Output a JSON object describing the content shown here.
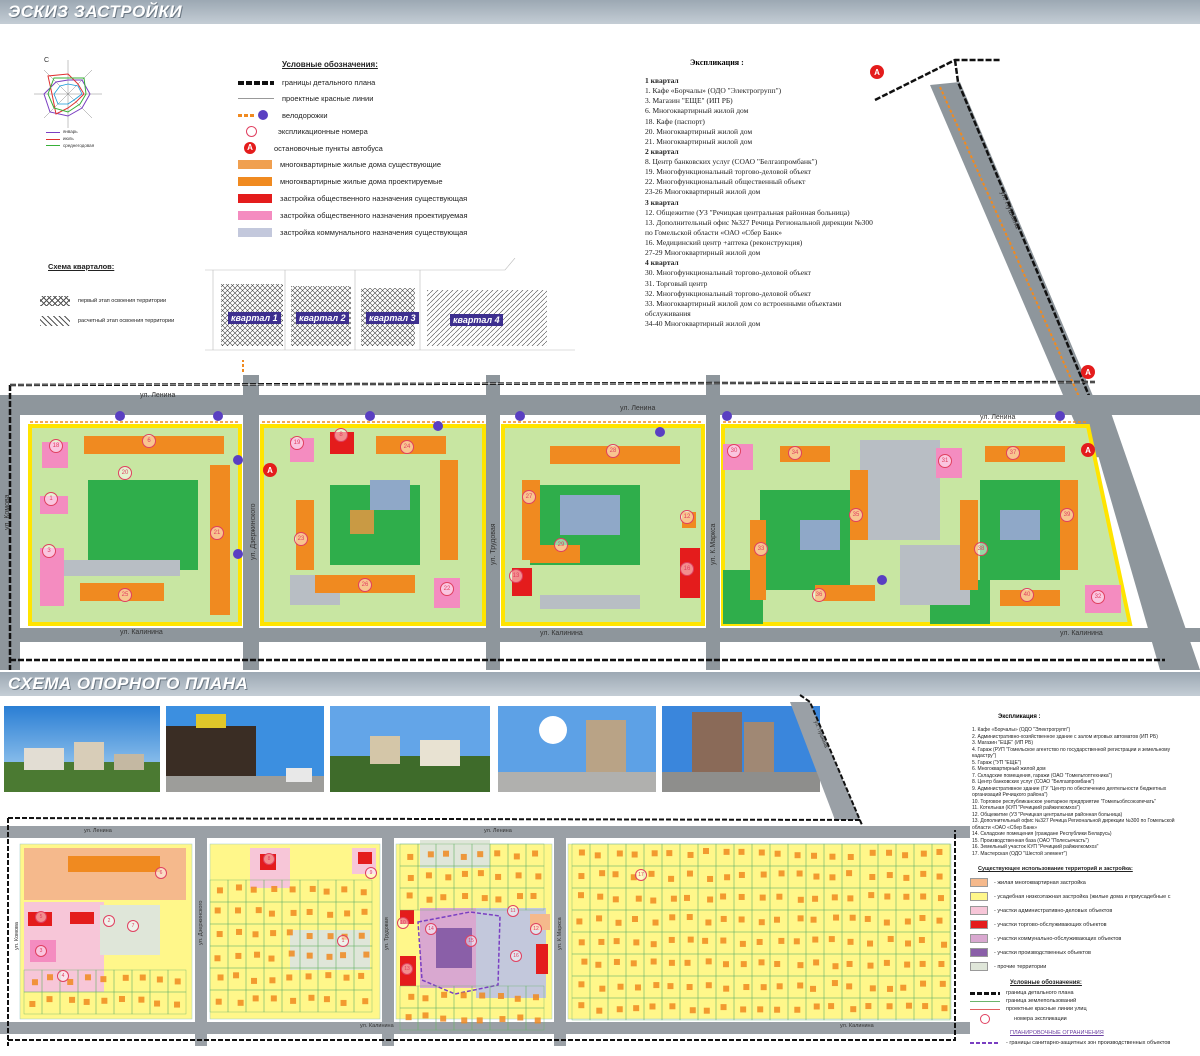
{
  "section1": {
    "title": "ЭСКИЗ ЗАСТРОЙКИ"
  },
  "section2": {
    "title": "СХЕМА ОПОРНОГО ПЛАНА"
  },
  "wind_rose": {
    "north": "С",
    "legend": [
      "январь",
      "июль",
      "среднегодовая"
    ],
    "colors": [
      "#7a3fc2",
      "#e03030",
      "#38b038"
    ]
  },
  "legend1": {
    "title": "Условные обозначения:",
    "items": [
      {
        "label": "границы детального плана",
        "type": "dash-black"
      },
      {
        "label": "проектные красные линии",
        "type": "thin"
      },
      {
        "label": "велодорожки",
        "type": "dash-orange"
      },
      {
        "label": "экспликационные номера",
        "type": "circle"
      },
      {
        "label": "остановочные пункты автобуса",
        "type": "bus",
        "symbol": "А"
      },
      {
        "label": "многоквартирные жилые дома существующие",
        "color": "#f0a050"
      },
      {
        "label": "многоквартирные жилые дома проектируемые",
        "color": "#f08a20"
      },
      {
        "label": "застройка общественного назначения существующая",
        "color": "#e41c1c"
      },
      {
        "label": "застройка общественного назначения проектируемая",
        "color": "#f48cc0"
      },
      {
        "label": "застройка коммунального назначения существующая",
        "color": "#c3c8dc"
      }
    ]
  },
  "quarters_scheme": {
    "title": "Схема кварталов:",
    "items": [
      {
        "label": "первый этап освоения территории"
      },
      {
        "label": "расчетный этап освоения территории"
      }
    ],
    "quarters": [
      "квартал 1",
      "квартал 2",
      "квартал 3",
      "квартал 4"
    ]
  },
  "explication1": {
    "title": "Экспликация :",
    "groups": [
      {
        "name": "1 квартал",
        "items": [
          "1.      Кафе «Борчалы» (ОДО \"Электрогрупп\")",
          "3.      Магазин \"ЕЩЕ\" (ИП РБ)",
          "6.      Многоквартирный жилой дом",
          "18.     Кафе (паспорт)",
          "20.     Многоквартирный жилой дом",
          "21.     Многоквартирный жилой дом"
        ]
      },
      {
        "name": "2 квартал",
        "items": [
          "8.      Центр банковских услуг (СОАО \"Белгазпромбанк\")",
          "19.     Многофункциональный торгово-деловой объект",
          "22.     Многофункциональный общественный объект",
          "23-26 Многоквартирный жилой дом"
        ]
      },
      {
        "name": "3 квартал",
        "items": [
          "12.      Общежитие (УЗ \"Речицкая центральная районная больница)",
          "13.      Дополнительный офис №327 Речица Региональной дирекции №300 по Гомельской области «ОАО «Сбер Банк»",
          "16.      Медицинский центр +аптека (реконструкция)",
          "27-29  Многоквартирный жилой дом"
        ]
      },
      {
        "name": "4 квартал",
        "items": [
          "30.      Многофункциональный торгово-деловой объект",
          "31.      Торговый центр",
          "32.      Многофункциональный торгово-деловой объект",
          "33.      Многоквартирный жилой дом со встроенными объектами обслуживания",
          "34-40  Многоквартирный жилой дом"
        ]
      }
    ]
  },
  "streets": {
    "lenina": "ул. Ленина",
    "kalinina": "ул. Калинина",
    "komsomolskaya": "ул. Комова",
    "dzerzhinskogo": "ул. Дзержинского",
    "trudovaya": "ул. Трудовая",
    "marksa": "ул. К.Маркса",
    "pushkina": "ул. Пушкина",
    "lenina_v": "ул. Ленина"
  },
  "labels1": [
    "1",
    "3",
    "6",
    "8",
    "12",
    "13",
    "16",
    "18",
    "19",
    "20",
    "21",
    "22",
    "23",
    "24",
    "25",
    "26",
    "27",
    "28",
    "29",
    "30",
    "31",
    "32",
    "33",
    "34",
    "35",
    "36",
    "37",
    "38",
    "39",
    "40"
  ],
  "explication2": {
    "title": "Экспликация :",
    "items": [
      "1.    Кафе «Борчалы» (ОДО \"Электрогрупп\")",
      "2.    Административно-хозяйственное здание с залом игровых автоматов (ИП РБ)",
      "3.    Магазин \"ЕЩЕ\" (ИП РБ)",
      "4.    Гараж (РУП \"Гомельское агентство по государственной регистрации и земельному кадастру\")",
      "5.    Гараж (\"УП \"ЕЩЕ\")",
      "6.    Многоквартирный жилой дом",
      "7.    Складские помещения, гаражи (ОАО \"Гомельтоптехника\")",
      "8.    Центр банковских услуг (СОАО \"Белгазпромбанк\")",
      "9.    Административное здание (ГУ \"Центр по обеспечению деятельности бюджетных организаций Речицкого района\")",
      "10.  Торговое республиканское унитарное предприятие \"Гомельоблсоюзпечать\"",
      "11.  Котельная (КУП \"Речицкий райжилкомхоз\")",
      "12.  Общежитие (УЗ \"Речицкая центральная районная больница)",
      "13.  Дополнительный офис №327 Речица Региональной дирекции №300 по Гомельской области «ОАО «Сбер Банк»",
      "14.  Складские помещения (граждане Республики Беларусь)",
      "15.  Производственная база (ОАО \"Полесьечасть\")",
      "16.  Земельный участок КУП \"Речицкий райжилкомхоз\"",
      "17.  Мастерская (ОДО \"Шестой элемент\")"
    ]
  },
  "legend2": {
    "title": "Существующее использование территорий и застройка:",
    "items": [
      {
        "label": "- жилая многоквартирная застройка",
        "color": "#f5b98c"
      },
      {
        "label": "- усадебная низкоэтажная застройка (жилые дома и приусадебные с",
        "color": "#fff78a"
      },
      {
        "label": "- участки административно-деловых объектов",
        "color": "#f7c6d8"
      },
      {
        "label": "- участки торгово-обслуживающих объектов",
        "color": "#e41c1c"
      },
      {
        "label": "- участки коммунально-обслуживающих объектов",
        "color": "#d9a8d0"
      },
      {
        "label": "- участки производственных объектов",
        "color": "#8a5fa8"
      },
      {
        "label": "- прочие территории",
        "color": "#dfe6d9"
      }
    ],
    "symbols_title": "Условные обозначения:",
    "symbols": [
      {
        "label": "граница детального плана"
      },
      {
        "label": "граница землепользований"
      },
      {
        "label": "проектные красные линии улиц"
      },
      {
        "label": "номера экспликации"
      }
    ],
    "restrictions_title": "ПЛАНИРОВОЧНЫЕ ОГРАНИЧЕНИЯ",
    "restrictions": [
      {
        "label": "- границы санитарно-защитных зон производственных объектов"
      }
    ]
  },
  "labels2": [
    "1",
    "2",
    "3",
    "4",
    "5",
    "6",
    "7",
    "8",
    "9",
    "10",
    "11",
    "12",
    "13",
    "14",
    "15",
    "16",
    "17"
  ]
}
